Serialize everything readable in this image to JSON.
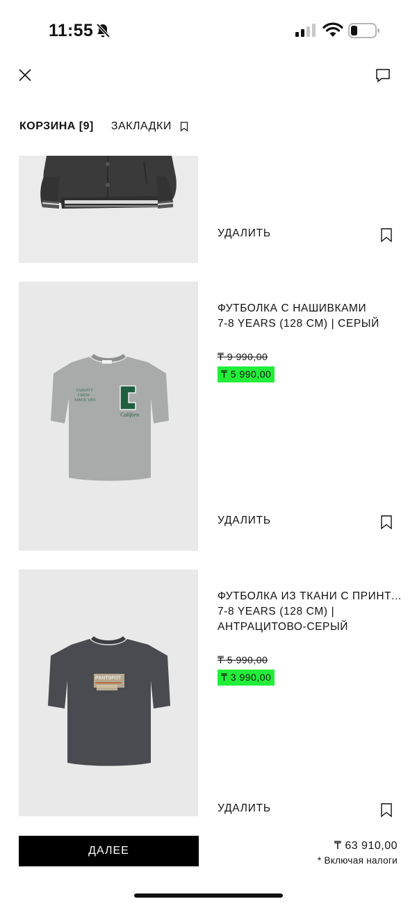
{
  "status_bar": {
    "time": "11:55",
    "icons": [
      "bell-slash-icon",
      "cellular-signal-icon",
      "wifi-icon",
      "battery-icon"
    ]
  },
  "topbar": {
    "close_icon": "close-icon",
    "chat_icon": "chat-icon"
  },
  "tabs": {
    "cart_label": "КОРЗИНА [9]",
    "bookmarks_label": "ЗАКЛАДКИ",
    "bookmarks_icon": "bookmark-icon"
  },
  "items": [
    {
      "image_icon": "jacket-photo",
      "delete_label": "УДАЛИТЬ",
      "save_icon": "bookmark-icon"
    },
    {
      "image_icon": "grey-tshirt-photo",
      "name": "ФУТБОЛКА С НАШИВКАМИ",
      "variant": "7-8 YEARS (128 CM) | СЕРЫЙ",
      "old_price": "₸ 9 990,00",
      "new_price": "₸ 5 990,00",
      "delete_label": "УДАЛИТЬ",
      "save_icon": "bookmark-icon"
    },
    {
      "image_icon": "anthracite-tshirt-photo",
      "name": "ФУТБОЛКА ИЗ ТКАНИ С ПРИНТОМ",
      "variant": "7-8 YEARS (128 CM) | АНТРАЦИТОВО-СЕРЫЙ",
      "old_price": "₸ 5 990,00",
      "new_price": "₸ 3 990,00",
      "delete_label": "УДАЛИТЬ",
      "save_icon": "bookmark-icon"
    }
  ],
  "footer": {
    "next_label": "ДАЛЕЕ",
    "total": "₸ 63 910,00",
    "tax_note": "* Включая налоги"
  },
  "colors": {
    "sale_highlight": "#22ee3a",
    "primary_button": "#000000",
    "photo_background": "#e9e9e9"
  }
}
